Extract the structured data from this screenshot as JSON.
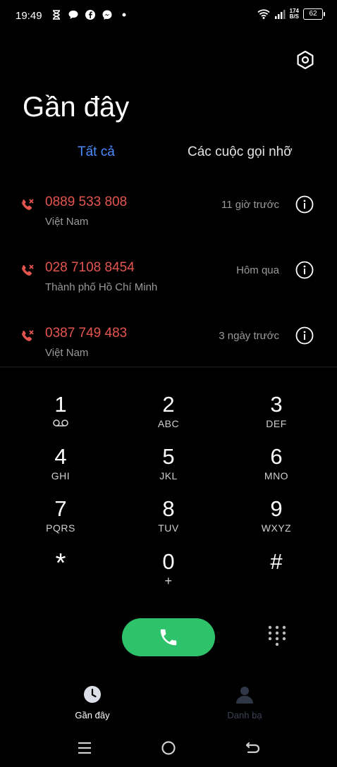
{
  "status_bar": {
    "time": "19:49",
    "net_speed_value": "174",
    "net_speed_unit": "B/S",
    "battery": "62"
  },
  "header": {
    "title": "Gần đây"
  },
  "tabs": {
    "all": "Tất cả",
    "missed": "Các cuộc gọi nhỡ"
  },
  "calls": [
    {
      "number": "0889 533 808",
      "location": "Việt Nam",
      "time": "11 giờ trước"
    },
    {
      "number": "028 7108 8454",
      "location": "Thành phố Hồ Chí Minh",
      "time": "Hôm qua"
    },
    {
      "number": "0387 749 483",
      "location": "Việt Nam",
      "time": "3 ngày trước"
    }
  ],
  "keypad": [
    {
      "digit": "1",
      "letters": ""
    },
    {
      "digit": "2",
      "letters": "ABC"
    },
    {
      "digit": "3",
      "letters": "DEF"
    },
    {
      "digit": "4",
      "letters": "GHI"
    },
    {
      "digit": "5",
      "letters": "JKL"
    },
    {
      "digit": "6",
      "letters": "MNO"
    },
    {
      "digit": "7",
      "letters": "PQRS"
    },
    {
      "digit": "8",
      "letters": "TUV"
    },
    {
      "digit": "9",
      "letters": "WXYZ"
    },
    {
      "digit": "*",
      "letters": ""
    },
    {
      "digit": "0",
      "letters": "+"
    },
    {
      "digit": "#",
      "letters": ""
    }
  ],
  "bottom_nav": {
    "recent": "Gần đây",
    "contacts": "Danh bạ"
  },
  "colors": {
    "accent": "#4a8cff",
    "missed": "#e5554f",
    "call_button": "#2ec26a"
  }
}
